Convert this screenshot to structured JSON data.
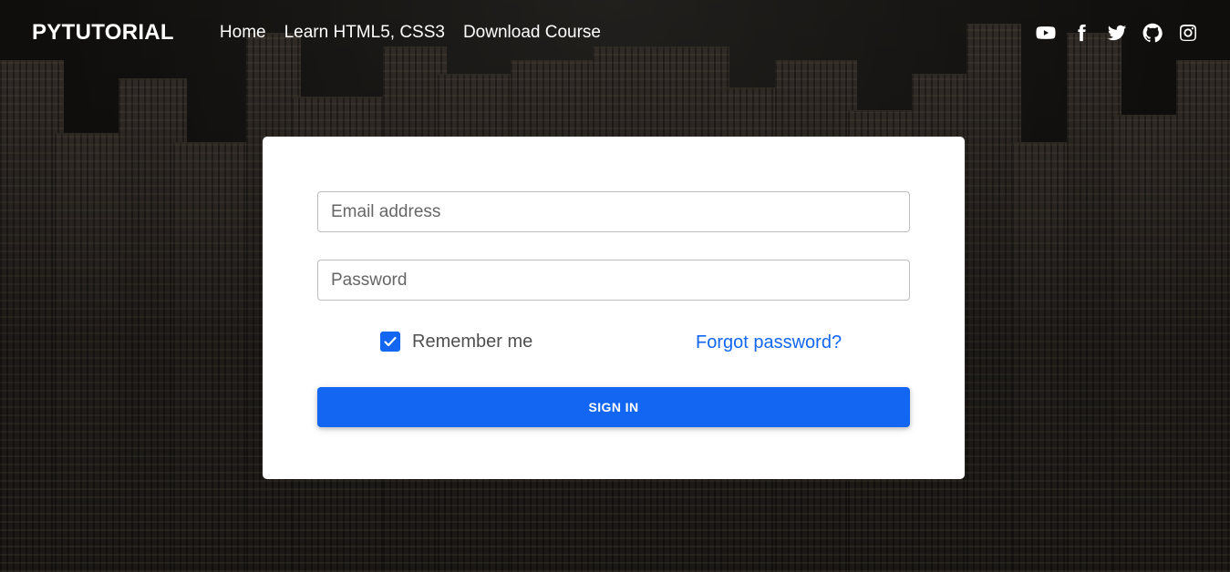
{
  "navbar": {
    "brand": "PYTUTORIAL",
    "links": [
      "Home",
      "Learn HTML5, CSS3",
      "Download Course"
    ],
    "social_icons": [
      "youtube-icon",
      "facebook-icon",
      "twitter-icon",
      "github-icon",
      "instagram-icon"
    ]
  },
  "form": {
    "email": {
      "placeholder": "Email address",
      "value": ""
    },
    "password": {
      "placeholder": "Password",
      "value": ""
    },
    "remember_label": "Remember me",
    "remember_checked": true,
    "forgot_label": "Forgot password?",
    "submit_label": "SIGN IN"
  },
  "colors": {
    "accent": "#1266f1",
    "card_bg": "#ffffff",
    "nav_text": "#ffffff"
  }
}
